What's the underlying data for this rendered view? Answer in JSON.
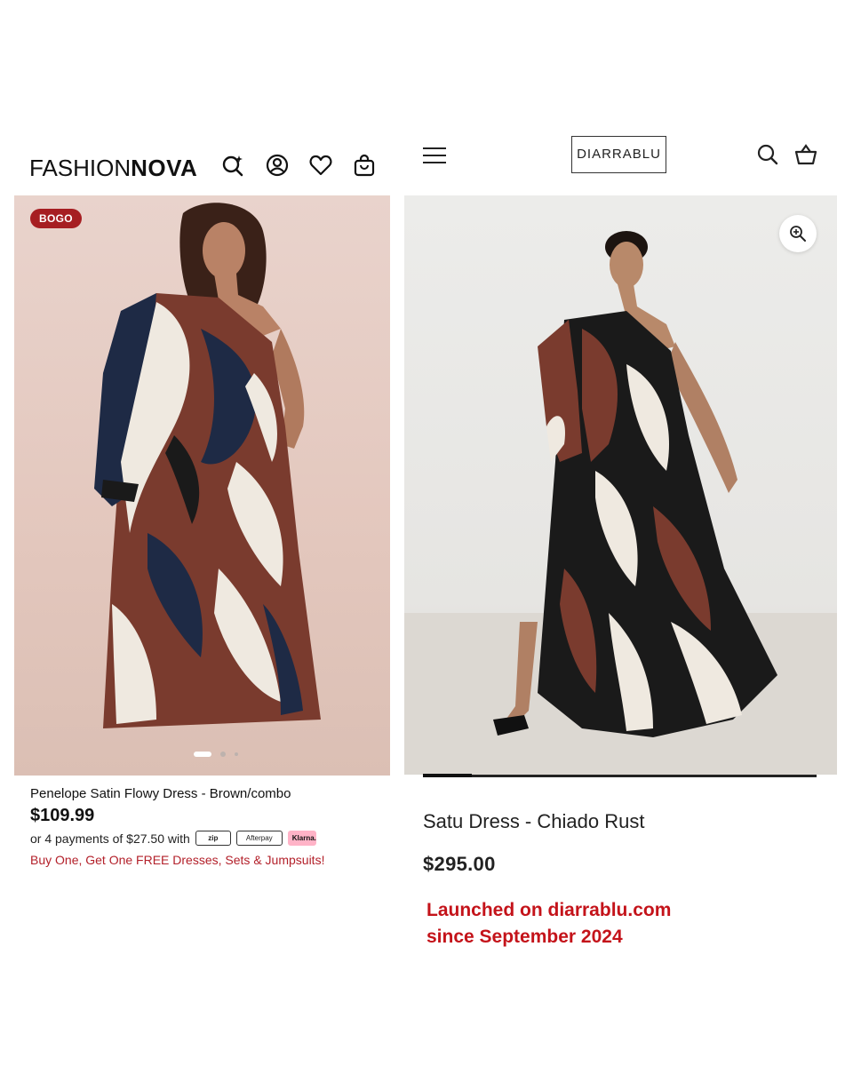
{
  "left_store": {
    "brand": {
      "part1": "FASHION",
      "part2": "NOVA"
    },
    "header_icons": [
      "search-sparkle-icon",
      "account-icon",
      "heart-icon",
      "bag-icon"
    ],
    "badge": "BOGO",
    "image_slide": {
      "current": 1,
      "total": 3
    },
    "product_name": "Penelope Satin Flowy Dress - Brown/combo",
    "price": "$109.99",
    "installments": {
      "text": "or 4 payments of $27.50 with",
      "providers": [
        "zip",
        "Afterpay",
        "Klarna."
      ]
    },
    "promo": "Buy One, Get One FREE Dresses, Sets & Jumpsuits!"
  },
  "right_store": {
    "brand": "DIARRABLU",
    "header_icons": [
      "menu-icon",
      "search-icon",
      "basket-icon"
    ],
    "zoom_icon": "zoom-in-icon",
    "image_progress": 0.125,
    "product_name": "Satu Dress - Chiado Rust",
    "price": "$295.00"
  },
  "annotation": {
    "line1": "Launched on diarrablu.com",
    "line2": "since September 2024"
  },
  "colors": {
    "promo_red": "#b3202a",
    "badge_red": "#a61e22",
    "annotation_red": "#c4131a",
    "dress_brown": "#7a3b2e",
    "dress_navy": "#1e2a45",
    "dress_cream": "#efe9e0",
    "dress_black": "#1a1a1a"
  }
}
